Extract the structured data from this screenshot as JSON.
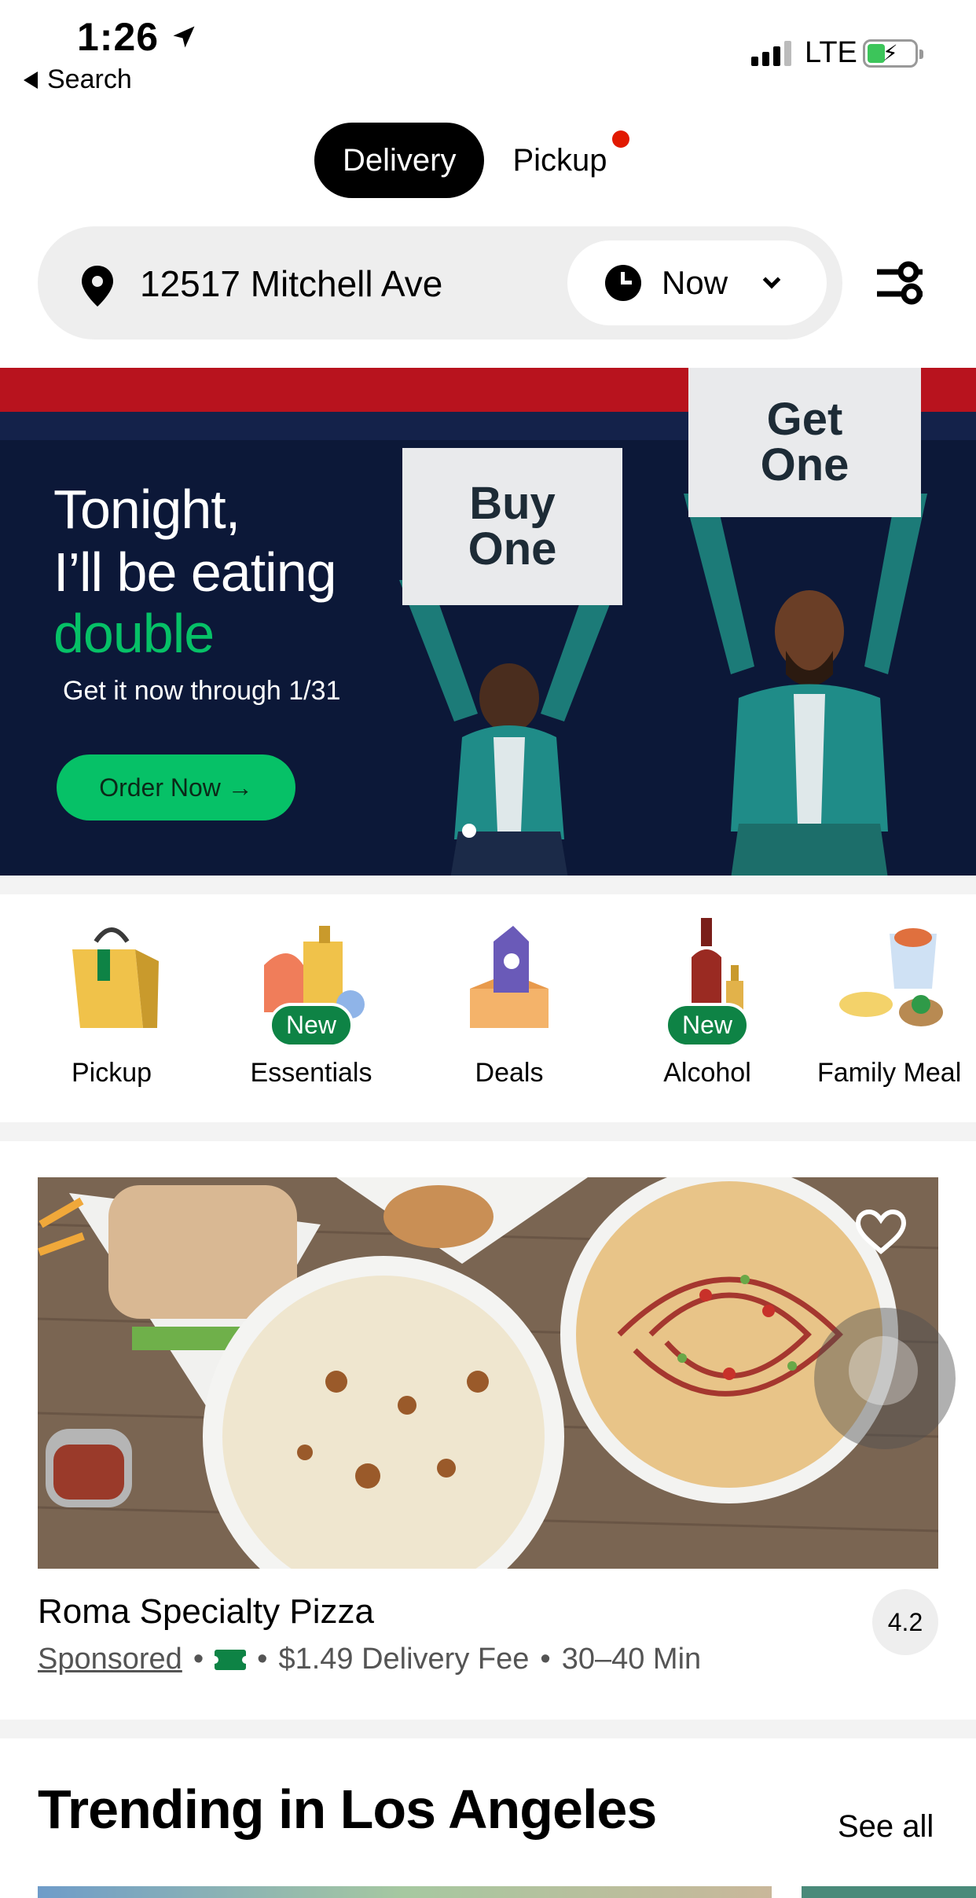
{
  "status_bar": {
    "time": "1:26",
    "back_label": "Search",
    "network": "LTE"
  },
  "mode_toggle": {
    "delivery_label": "Delivery",
    "pickup_label": "Pickup"
  },
  "address_bar": {
    "address": "12517 Mitchell Ave",
    "time_label": "Now"
  },
  "hero": {
    "line1": "Tonight,",
    "line2": "I’ll be eating",
    "line3": "double",
    "subtitle": "Get it now through 1/31",
    "cta": "Order Now →",
    "sign_left_1": "Buy",
    "sign_left_2": "One",
    "sign_right_1": "Get",
    "sign_right_2": "One",
    "accent_color": "#06c167"
  },
  "categories": [
    {
      "label": "Pickup",
      "badge": ""
    },
    {
      "label": "Essentials",
      "badge": "New"
    },
    {
      "label": "Deals",
      "badge": ""
    },
    {
      "label": "Alcohol",
      "badge": "New"
    },
    {
      "label": "Family Meal",
      "badge": ""
    }
  ],
  "restaurant": {
    "name": "Roma Specialty Pizza",
    "rating": "4.2",
    "sponsored": "Sponsored",
    "delivery_fee": "$1.49 Delivery Fee",
    "eta": "30–40 Min",
    "separator": "•"
  },
  "trending": {
    "title": "Trending in Los Angeles",
    "see_all": "See all"
  }
}
